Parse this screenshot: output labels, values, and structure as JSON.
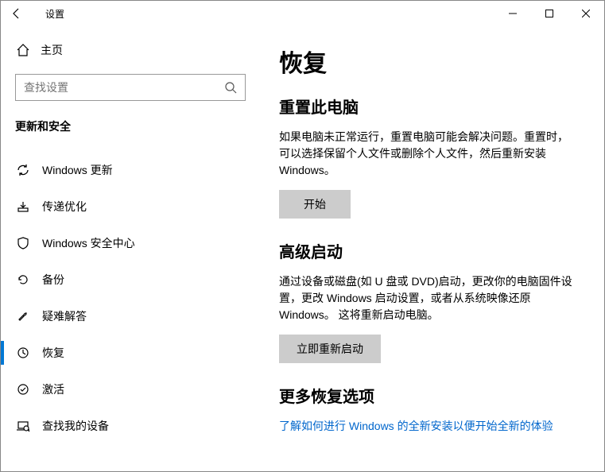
{
  "window": {
    "title": "设置"
  },
  "sidebar": {
    "home": "主页",
    "search_placeholder": "查找设置",
    "section": "更新和安全",
    "items": [
      {
        "label": "Windows 更新"
      },
      {
        "label": "传递优化"
      },
      {
        "label": "Windows 安全中心"
      },
      {
        "label": "备份"
      },
      {
        "label": "疑难解答"
      },
      {
        "label": "恢复"
      },
      {
        "label": "激活"
      },
      {
        "label": "查找我的设备"
      }
    ]
  },
  "main": {
    "heading": "恢复",
    "reset": {
      "heading": "重置此电脑",
      "desc": "如果电脑未正常运行，重置电脑可能会解决问题。重置时，可以选择保留个人文件或删除个人文件，然后重新安装 Windows。",
      "button": "开始"
    },
    "adv": {
      "heading": "高级启动",
      "desc": "通过设备或磁盘(如 U 盘或 DVD)启动，更改你的电脑固件设置，更改 Windows 启动设置，或者从系统映像还原 Windows。 这将重新启动电脑。",
      "button": "立即重新启动"
    },
    "more": {
      "heading": "更多恢复选项",
      "link": "了解如何进行 Windows 的全新安装以便开始全新的体验"
    }
  }
}
